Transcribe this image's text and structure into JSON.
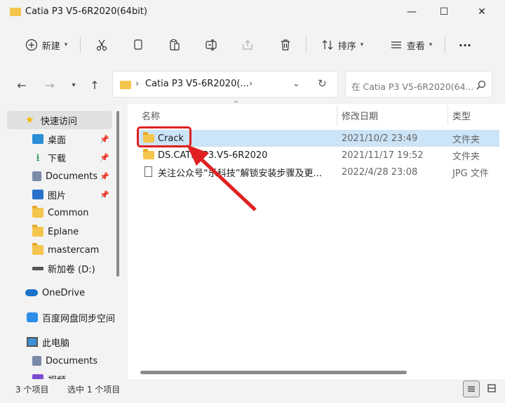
{
  "window": {
    "title": "Catia P3 V5-6R2020(64bit)",
    "min": "—",
    "max": "☐",
    "close": "✕"
  },
  "toolbar": {
    "new_label": "新建",
    "sort_label": "排序",
    "view_label": "查看",
    "more": "···"
  },
  "nav": {
    "address_text": "Catia P3 V5-6R2020(...",
    "search_placeholder": "在 Catia P3 V5-6R2020(64..."
  },
  "sidebar": {
    "items": [
      {
        "label": "快速访问",
        "icon": "star-icon"
      },
      {
        "label": "桌面",
        "icon": "desktop-icon",
        "pinned": true
      },
      {
        "label": "下载",
        "icon": "download-icon",
        "pinned": true
      },
      {
        "label": "Documents",
        "icon": "document-icon",
        "pinned": true
      },
      {
        "label": "图片",
        "icon": "picture-icon",
        "pinned": true
      },
      {
        "label": "Common",
        "icon": "folder-icon"
      },
      {
        "label": "Eplane",
        "icon": "folder-icon"
      },
      {
        "label": "mastercam",
        "icon": "folder-icon"
      },
      {
        "label": "新加卷 (D:)",
        "icon": "drive-icon"
      },
      {
        "label": "OneDrive",
        "icon": "cloud-icon"
      },
      {
        "label": "百度网盘同步空间",
        "icon": "baidu-icon"
      },
      {
        "label": "此电脑",
        "icon": "computer-icon"
      },
      {
        "label": "Documents",
        "icon": "document-icon"
      },
      {
        "label": "视频",
        "icon": "video-icon"
      }
    ]
  },
  "columns": {
    "name": "名称",
    "modified": "修改日期",
    "type": "类型"
  },
  "files": [
    {
      "name": "Crack",
      "date": "2021/10/2 23:49",
      "type": "文件夹",
      "selected": true
    },
    {
      "name": "DS.CATIA.P3.V5-6R2020",
      "date": "2021/11/17 19:52",
      "type": "文件夹",
      "selected": false
    },
    {
      "name": "关注公众号“乐科技”解锁安装步骤及更...",
      "date": "2022/4/28 23:08",
      "type": "JPG 文件",
      "selected": false
    }
  ],
  "status": {
    "count": "3 个项目",
    "selection": "选中 1 个项目"
  },
  "colors": {
    "selection": "#cce4f7",
    "accent": "#0067c0",
    "highlight_red": "#e02020"
  }
}
